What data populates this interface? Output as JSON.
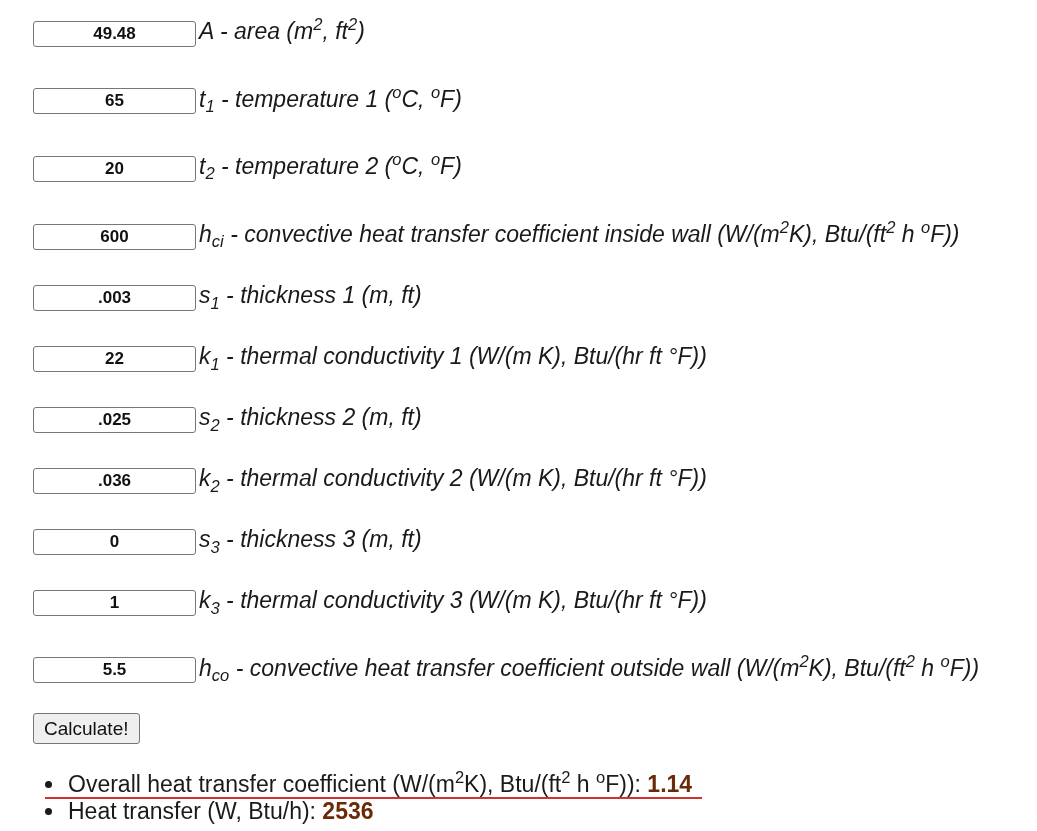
{
  "fields": [
    {
      "value": "49.48",
      "label": "A - area (m$^{2}$, ft$^{2}$)"
    },
    {
      "value": "65",
      "label": "t$_{1}$ - temperature 1 ($^{o}$C, $^{o}$F)"
    },
    {
      "value": "20",
      "label": "t$_{2}$ - temperature 2 ($^{o}$C, $^{o}$F)"
    },
    {
      "value": "600",
      "label": "h$_{ci}$ - convective heat transfer coefficient inside wall (W/(m$^{2}$K), Btu/(ft$^{2}$ h $^{o}$F))"
    },
    {
      "value": ".003",
      "label": "s$_{1}$ - thickness 1 (m, ft)"
    },
    {
      "value": "22",
      "label": "k$_{1}$ - thermal conductivity 1 (W/(m K), Btu/(hr ft °F))"
    },
    {
      "value": ".025",
      "label": "s$_{2}$ - thickness 2 (m, ft)"
    },
    {
      "value": ".036",
      "label": "k$_{2}$ - thermal conductivity 2 (W/(m K), Btu/(hr ft °F))"
    },
    {
      "value": "0",
      "label": "s$_{3}$ - thickness 3 (m, ft)"
    },
    {
      "value": "1",
      "label": "k$_{3}$ - thermal conductivity 3 (W/(m K), Btu/(hr ft °F))"
    },
    {
      "value": "5.5",
      "label": "h$_{co}$ - convective heat transfer coefficient outside wall (W/(m$^{2}$K), Btu/(ft$^{2}$ h $^{o}$F))"
    }
  ],
  "calculate_button": {
    "label": "Calculate!"
  },
  "results": [
    {
      "label": "Overall heat transfer coefficient (W/(m$^{2}$K), Btu/(ft$^{2}$ h $^{o}$F)):",
      "value": "1.14",
      "highlighted": true
    },
    {
      "label": "Heat transfer (W, Btu/h):",
      "value": "2536",
      "highlighted": false
    }
  ]
}
